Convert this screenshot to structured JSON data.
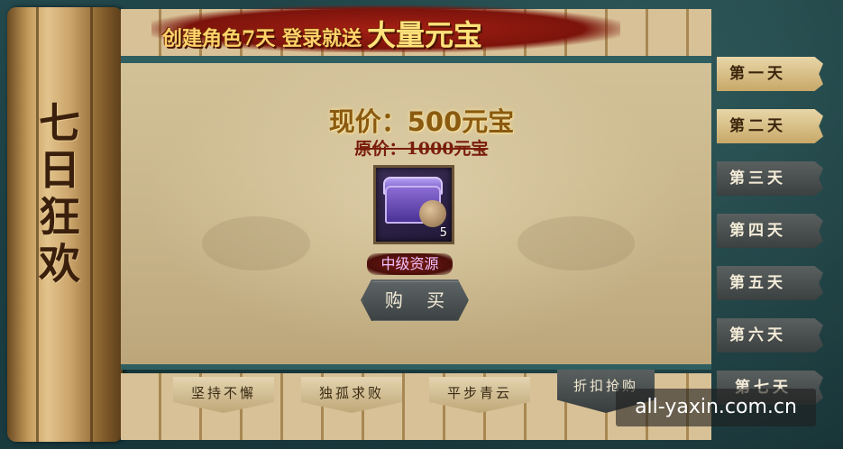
{
  "banner": {
    "text": "创建角色7天 登录就送",
    "highlight": "大量元宝"
  },
  "panel_title": "七日狂欢",
  "offer": {
    "current_price": "现价：500元宝",
    "original_price": "原价：1000元宝",
    "item_name": "中级资源",
    "item_count": "5",
    "buy_label": "购 买"
  },
  "bottom_tabs": [
    {
      "label": "坚持不懈"
    },
    {
      "label": "独孤求败"
    },
    {
      "label": "平步青云"
    },
    {
      "label": "折扣抢购"
    }
  ],
  "day_tabs": [
    {
      "label": "第一天",
      "state": "active"
    },
    {
      "label": "第二天",
      "state": "active"
    },
    {
      "label": "第三天",
      "state": "inactive"
    },
    {
      "label": "第四天",
      "state": "inactive"
    },
    {
      "label": "第五天",
      "state": "inactive"
    },
    {
      "label": "第六天",
      "state": "inactive"
    },
    {
      "label": "第七天",
      "state": "inactive"
    }
  ],
  "watermark": "all-yaxin.com.cn",
  "colors": {
    "background": "#1f3f42",
    "paper": "#c7b388",
    "price": "#8a5a10",
    "old_price": "#7a1d0c",
    "banner_red": "#a41f14",
    "banner_gold": "#ffd36a"
  }
}
